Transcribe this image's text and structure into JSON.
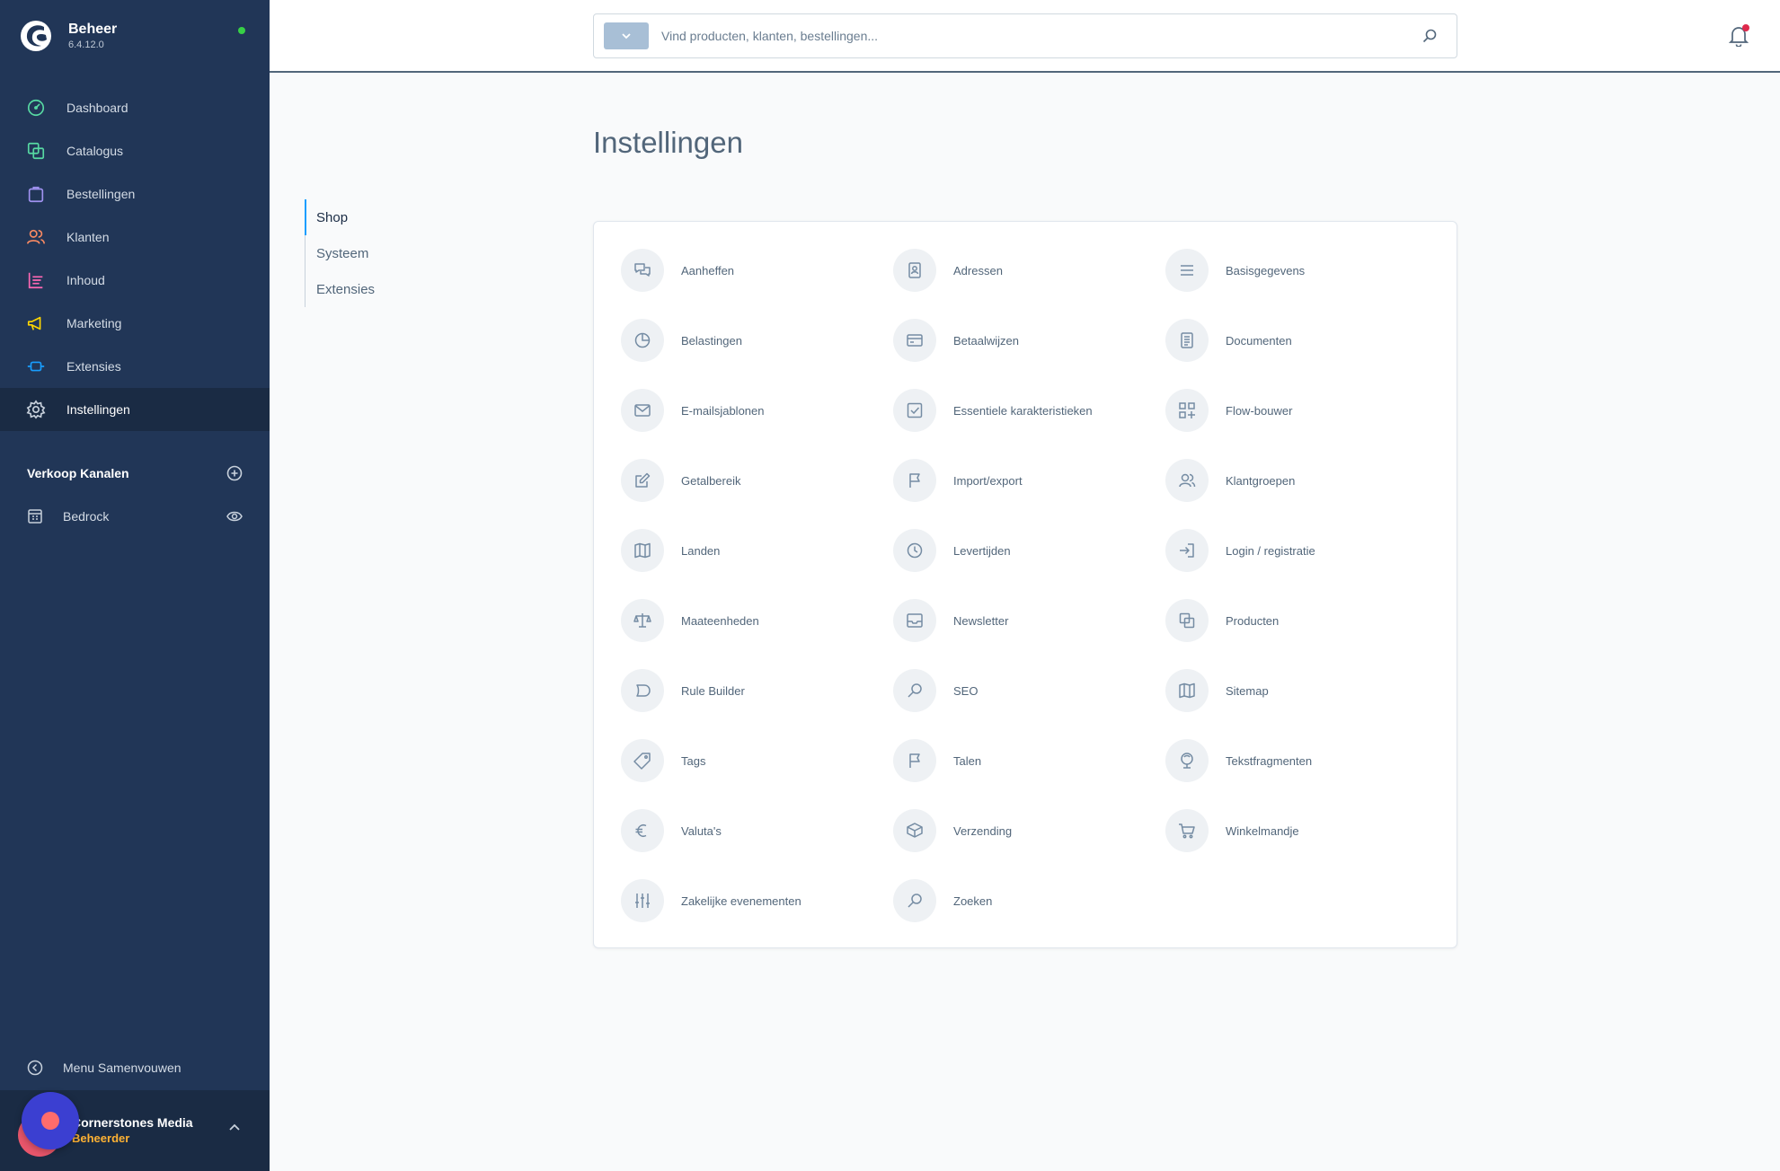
{
  "app": {
    "title": "Beheer",
    "version": "6.4.12.0"
  },
  "nav": [
    {
      "label": "Dashboard",
      "icon": "dashboard-icon",
      "color": "#57d9a3"
    },
    {
      "label": "Catalogus",
      "icon": "catalogue-icon",
      "color": "#57d9a3"
    },
    {
      "label": "Bestellingen",
      "icon": "orders-icon",
      "color": "#a092f0"
    },
    {
      "label": "Klanten",
      "icon": "customers-icon",
      "color": "#f88962"
    },
    {
      "label": "Inhoud",
      "icon": "content-icon",
      "color": "#ff68b4"
    },
    {
      "label": "Marketing",
      "icon": "marketing-icon",
      "color": "#ffd700"
    },
    {
      "label": "Extensies",
      "icon": "extensions-icon",
      "color": "#189eff"
    },
    {
      "label": "Instellingen",
      "icon": "settings-icon",
      "color": "#c8d1dc"
    }
  ],
  "sales_channels": {
    "title": "Verkoop Kanalen",
    "items": [
      {
        "label": "Bedrock"
      }
    ]
  },
  "collapse_label": "Menu Samenvouwen",
  "user": {
    "name": "Cornerstones Media",
    "role": "Beheerder"
  },
  "search": {
    "placeholder": "Vind producten, klanten, bestellingen..."
  },
  "page_title": "Instellingen",
  "tabs": [
    "Shop",
    "Systeem",
    "Extensies"
  ],
  "settings": [
    "Aanheffen",
    "Adressen",
    "Basisgegevens",
    "Belastingen",
    "Betaalwijzen",
    "Documenten",
    "E-mailsjablonen",
    "Essentiele karakteristieken",
    "Flow-bouwer",
    "Getalbereik",
    "Import/export",
    "Klantgroepen",
    "Landen",
    "Levertijden",
    "Login / registratie",
    "Maateenheden",
    "Newsletter",
    "Producten",
    "Rule Builder",
    "SEO",
    "Sitemap",
    "Tags",
    "Talen",
    "Tekstfragmenten",
    "Valuta's",
    "Verzending",
    "Winkelmandje",
    "Zakelijke evenementen",
    "Zoeken"
  ],
  "colors": {
    "sidebar": "#213657",
    "accent": "#189eff",
    "status_online": "#37d046",
    "notification": "#de294c"
  }
}
